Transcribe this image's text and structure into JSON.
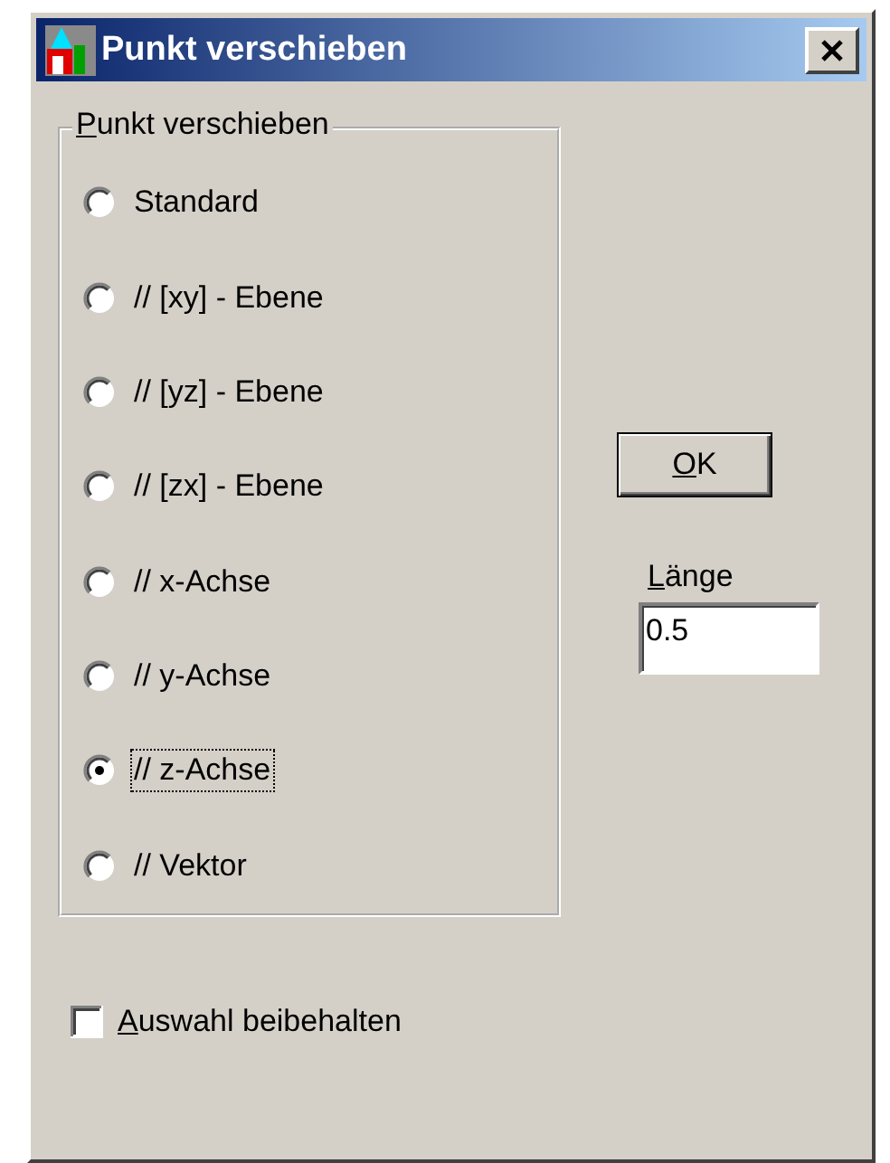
{
  "window": {
    "title": "Punkt verschieben"
  },
  "group": {
    "label": "Punkt verschieben",
    "underline_first": true
  },
  "options": [
    {
      "label": "Standard",
      "selected": false,
      "focused": false
    },
    {
      "label": "// [xy] - Ebene",
      "selected": false,
      "focused": false
    },
    {
      "label": "// [yz] - Ebene",
      "selected": false,
      "focused": false
    },
    {
      "label": "// [zx] - Ebene",
      "selected": false,
      "focused": false
    },
    {
      "label": "// x-Achse",
      "selected": false,
      "focused": false
    },
    {
      "label": "// y-Achse",
      "selected": false,
      "focused": false
    },
    {
      "label": "// z-Achse",
      "selected": true,
      "focused": true
    },
    {
      "label": "// Vektor",
      "selected": false,
      "focused": false
    }
  ],
  "ok_button": {
    "label": "OK",
    "underline_first": true
  },
  "length": {
    "label": "Länge",
    "underline_first": true,
    "value": "0.5"
  },
  "keep_selection": {
    "label": "Auswahl beibehalten",
    "underline_first": true,
    "checked": false
  }
}
